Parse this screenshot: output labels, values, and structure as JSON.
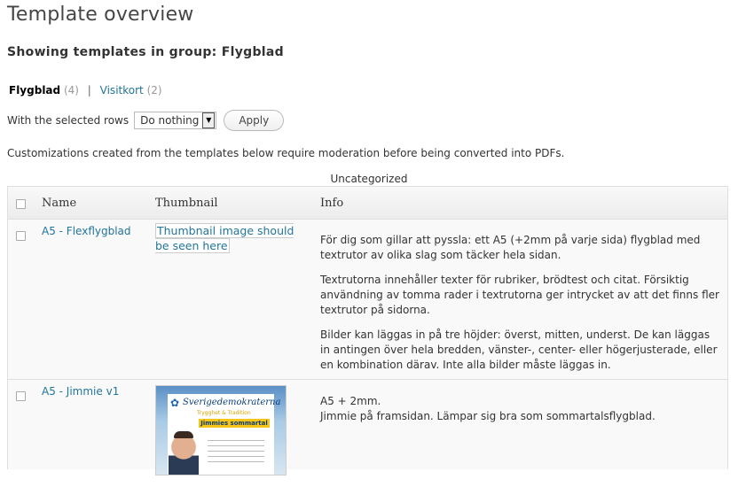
{
  "page": {
    "title": "Template overview",
    "subtitle": "Showing templates in group: Flygblad"
  },
  "groups": [
    {
      "label": "Flygblad",
      "count": "(4)",
      "current": true
    },
    {
      "label": "Visitkort",
      "count": "(2)",
      "current": false
    }
  ],
  "groups_separator": "|",
  "bulk": {
    "label": "With the selected rows",
    "selected": "Do nothing",
    "apply_label": "Apply"
  },
  "notice": "Customizations created from the templates below require moderation before being converted into PDFs.",
  "table": {
    "caption": "Uncategorized",
    "headers": {
      "name": "Name",
      "thumbnail": "Thumbnail",
      "info": "Info"
    },
    "rows": [
      {
        "name": "A5 - Flexflygblad",
        "thumbnail_text": "Thumbnail image should be seen here",
        "info": [
          "För dig som gillar att pyssla: ett A5 (+2mm på varje sida) flygblad med textrutor av olika slag som täcker hela sidan.",
          "Textrutorna innehåller texter för rubriker, brödtest och citat. Försiktig användning av tomma rader i textrutorna ger intrycket av att det finns fler textrutor på sidorna.",
          "Bilder kan läggas in på tre höjder: överst, mitten, underst. De kan läggas in antingen över hela bredden, vänster-, center- eller högerjusterade, eller en kombination därav. Inte alla bilder måste läggas in."
        ]
      },
      {
        "name": "A5 - Jimmie v1",
        "thumbnail_image": {
          "logo_text": "Sverigedemokraterna",
          "logo_sub": "Trygghet & Tradition",
          "banner": "Jimmies sommartal"
        },
        "info": [
          "A5 + 2mm.",
          "Jimmie på framsidan. Lämpar sig bra som sommartalsflygblad."
        ]
      }
    ]
  },
  "colors": {
    "link": "#21759b",
    "header_bg": "#ececec",
    "border": "#dfdfdf"
  }
}
